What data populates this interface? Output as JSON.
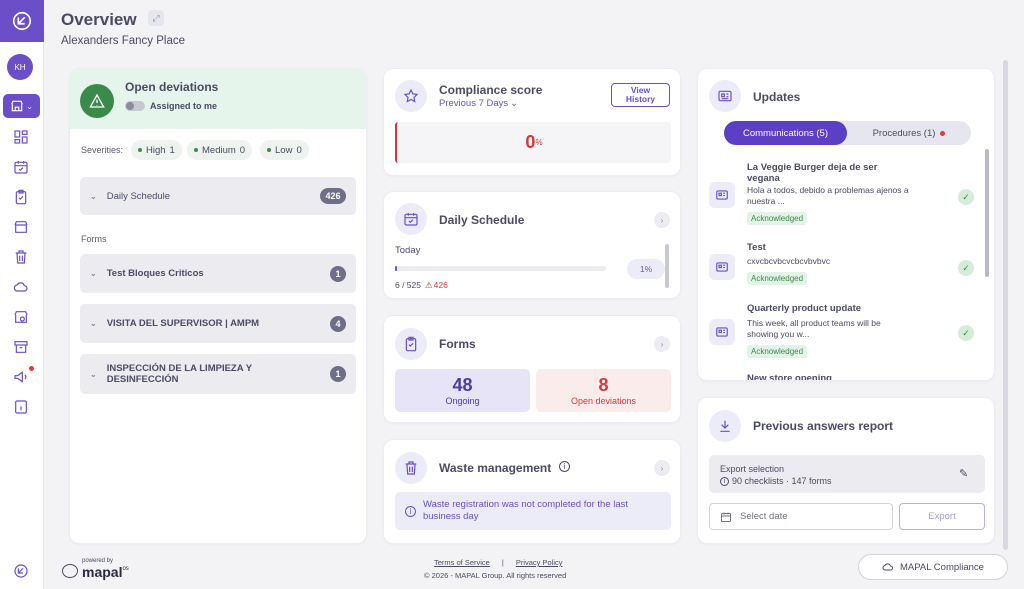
{
  "header": {
    "title": "Overview",
    "subtitle": "Alexanders Fancy Place"
  },
  "sidebar": {
    "avatar_initials": "KH"
  },
  "deviations": {
    "title": "Open deviations",
    "toggle_label": "Assigned to me",
    "severities_label": "Severities:",
    "severities": [
      {
        "label": "High",
        "count": "1"
      },
      {
        "label": "Medium",
        "count": "0"
      },
      {
        "label": "Low",
        "count": "0"
      }
    ],
    "daily_schedule": {
      "label": "Daily Schedule",
      "count": "426"
    },
    "forms_label": "Forms",
    "forms": [
      {
        "label": "Test Bloques Criticos",
        "count": "1"
      },
      {
        "label": "VISITA DEL SUPERVISOR | AMPM",
        "count": "4"
      },
      {
        "label": "INSPECCIÓN DE LA LIMPIEZA Y DESINFECCIÓN",
        "count": "1"
      }
    ]
  },
  "compliance": {
    "title": "Compliance score",
    "period": "Previous 7 Days",
    "view_history_label": "View History",
    "score": "0",
    "unit": "%"
  },
  "daily_schedule": {
    "title": "Daily Schedule",
    "today_label": "Today",
    "progress_fraction": 0.01,
    "percent_label": "1%",
    "done": "6 / 525",
    "deviations": "426"
  },
  "forms": {
    "title": "Forms",
    "ongoing_value": "48",
    "ongoing_label": "Ongoing",
    "open_value": "8",
    "open_label": "Open deviations"
  },
  "waste": {
    "title": "Waste management",
    "alert": "Waste registration was not completed for the last business day"
  },
  "updates": {
    "title": "Updates",
    "tab_communications": "Communications (5)",
    "tab_procedures": "Procedures (1)",
    "items": [
      {
        "title": "La Veggie Burger deja de ser vegana",
        "body": "Hola a todos, debido a problemas ajenos a nuestra ...",
        "status": "Acknowledged"
      },
      {
        "title": "Test",
        "body": "cxvcbcvbcvcbcvbvbvc",
        "status": "Acknowledged"
      },
      {
        "title": "Quarterly product update",
        "body": "This week, all product teams will be showing you w...",
        "status": "Acknowledged"
      },
      {
        "title": "New store opening",
        "body": "",
        "status": ""
      }
    ]
  },
  "report": {
    "title": "Previous answers report",
    "export_selection_label": "Export selection",
    "export_summary": "90 checklists · 147 forms",
    "date_placeholder": "Select date",
    "export_button": "Export"
  },
  "footer": {
    "powered_by": "powered by",
    "brand": "mapal",
    "brand_suffix": "os",
    "terms": "Terms of Service",
    "separator": "|",
    "privacy": "Privacy Policy",
    "copyright": "© 2026 - MAPAL Group. All rights reserved",
    "compliance_button": "MAPAL Compliance"
  },
  "colors": {
    "accent": "#6a4fc8",
    "danger": "#d23a3a",
    "success": "#3a8a4a",
    "deviation_header": "#e6f5ec"
  }
}
